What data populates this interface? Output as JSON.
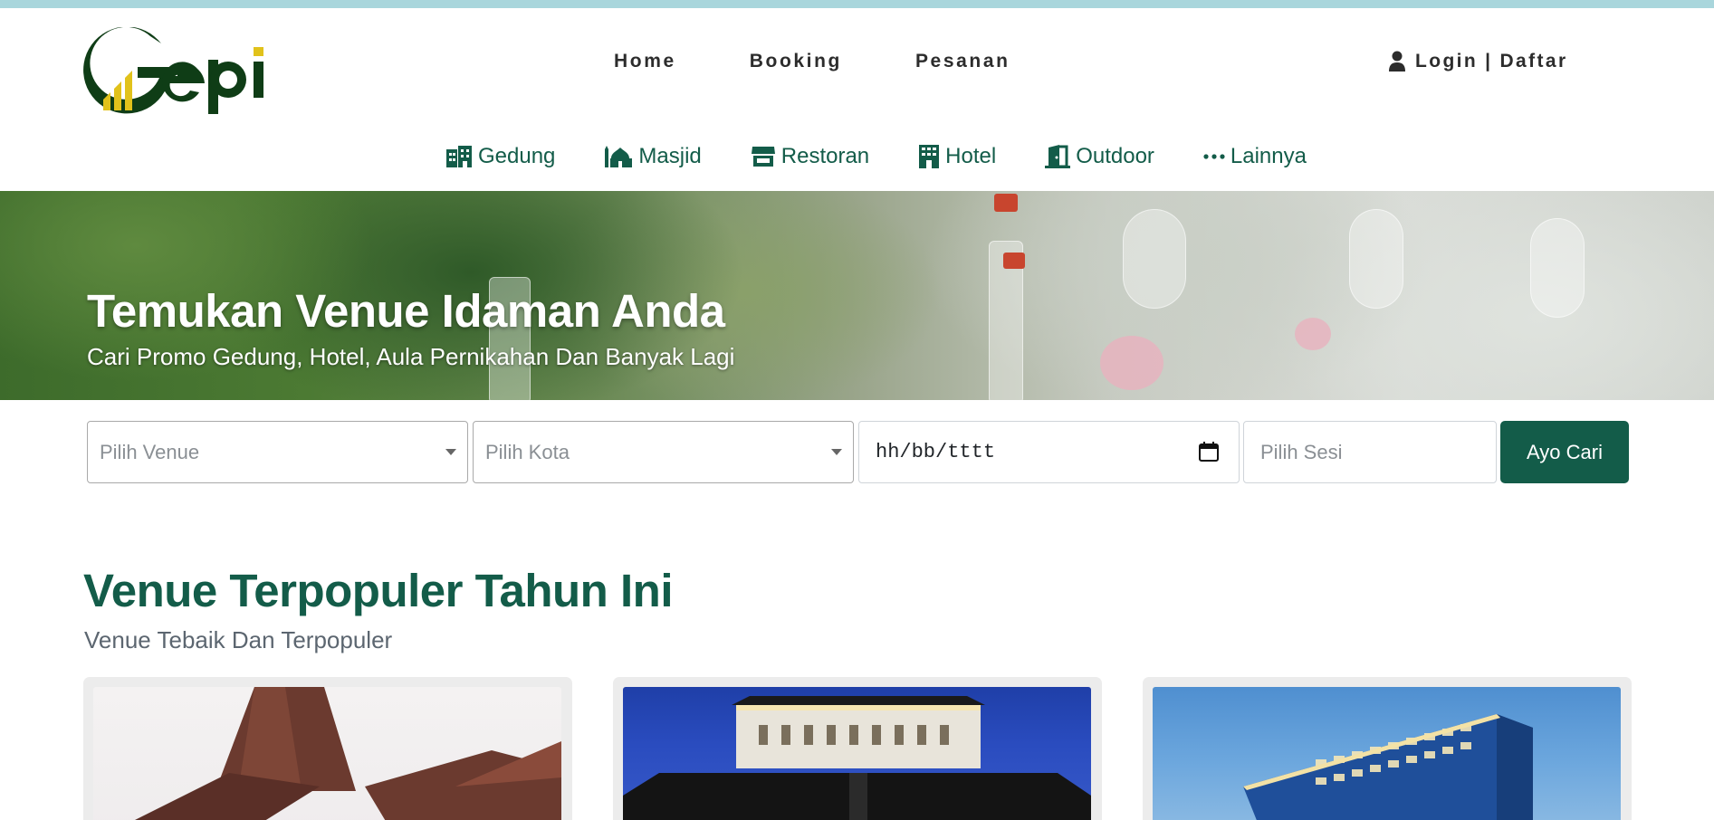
{
  "brand": {
    "name": "Gepi",
    "colors": {
      "primary": "#135c49",
      "logo_dark": "#0f3d16",
      "logo_accent": "#e1c21b"
    }
  },
  "nav": {
    "items": [
      "Home",
      "Booking",
      "Pesanan"
    ]
  },
  "auth": {
    "icon": "user-icon",
    "login": "Login",
    "separator": "|",
    "register": "Daftar"
  },
  "categories": [
    {
      "label": "Gedung",
      "icon": "building-icon"
    },
    {
      "label": "Masjid",
      "icon": "mosque-icon"
    },
    {
      "label": "Restoran",
      "icon": "store-icon"
    },
    {
      "label": "Hotel",
      "icon": "hotel-icon"
    },
    {
      "label": "Outdoor",
      "icon": "door-open-icon"
    },
    {
      "label": "Lainnya",
      "icon": "ellipsis-icon"
    }
  ],
  "hero": {
    "title": "Temukan Venue Idaman Anda",
    "subtitle": "Cari Promo Gedung, Hotel, Aula Pernikahan Dan Banyak Lagi"
  },
  "search": {
    "venue_placeholder": "Pilih Venue",
    "city_placeholder": "Pilih Kota",
    "date_placeholder": "hh/bb/tttt",
    "session_placeholder": "Pilih Sesi",
    "submit_label": "Ayo Cari"
  },
  "popular": {
    "title": "Venue Terpopuler Tahun Ini",
    "subtitle": "Venue Tebaik Dan Terpopuler"
  }
}
